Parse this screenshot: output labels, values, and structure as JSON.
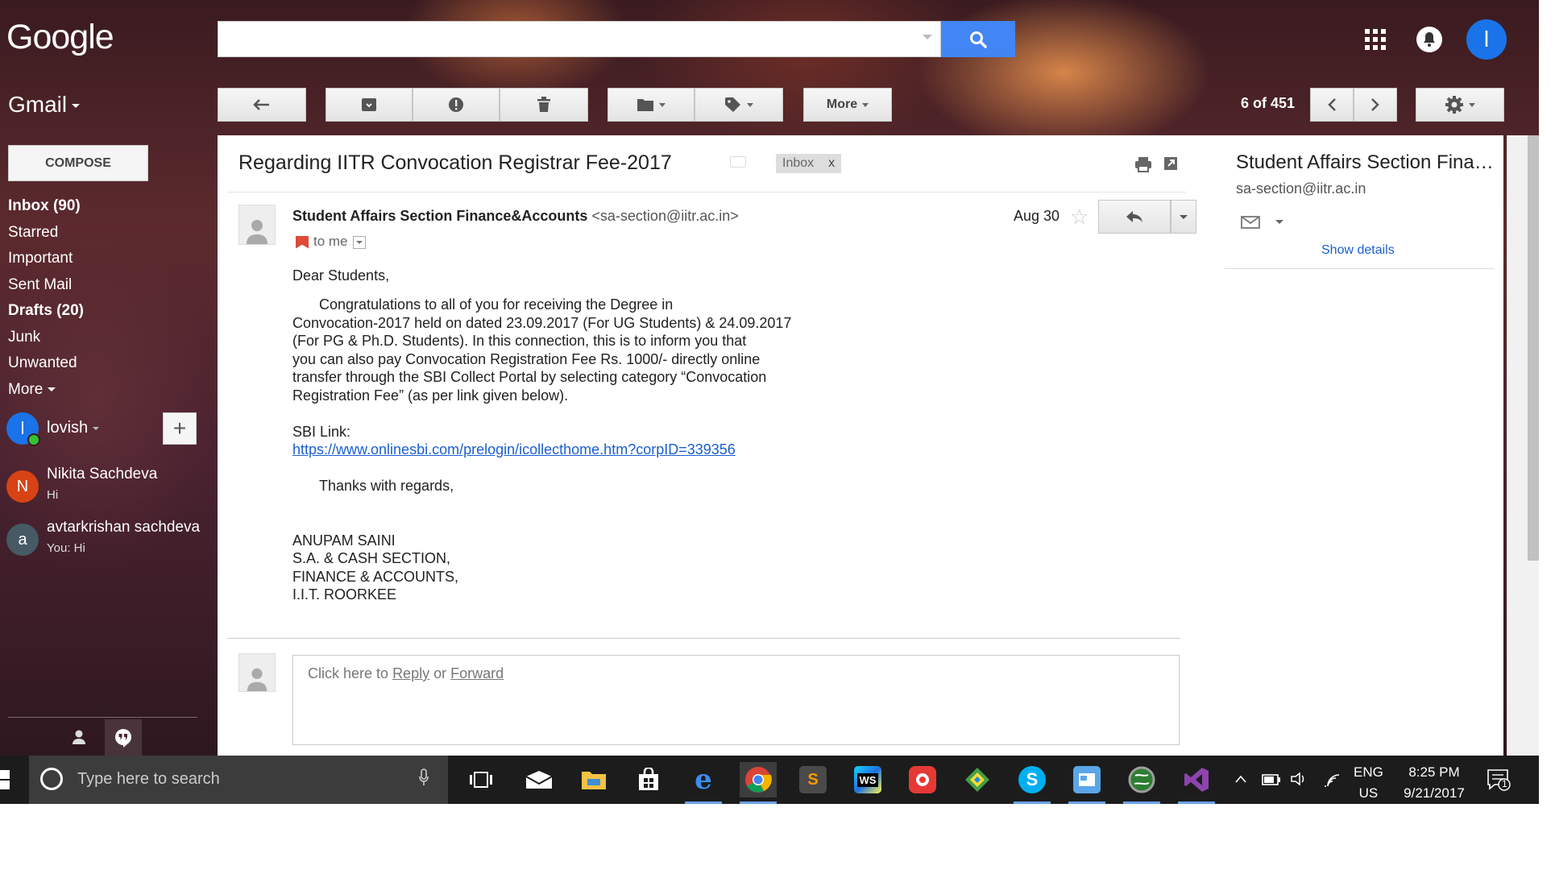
{
  "header": {
    "logo": "Google",
    "search_value": "",
    "search_icon": "magnifier-icon",
    "apps_icon": "apps-grid-icon",
    "notifications_icon": "bell-icon",
    "account_initial": "l"
  },
  "toolbar": {
    "app_label": "Gmail",
    "back_icon": "back-arrow-icon",
    "archive_icon": "archive-icon",
    "spam_icon": "report-spam-icon",
    "delete_icon": "trash-icon",
    "move_icon": "folder-icon",
    "labels_icon": "label-tag-icon",
    "more_label": "More",
    "count": "6 of 451",
    "prev_icon": "chevron-left-icon",
    "next_icon": "chevron-right-icon",
    "settings_icon": "gear-icon"
  },
  "sidebar": {
    "compose_label": "COMPOSE",
    "items": [
      {
        "label": "Inbox (90)",
        "bold": true
      },
      {
        "label": "Starred",
        "bold": false
      },
      {
        "label": "Important",
        "bold": false
      },
      {
        "label": "Sent Mail",
        "bold": false
      },
      {
        "label": "Drafts (20)",
        "bold": true
      },
      {
        "label": "Junk",
        "bold": false
      },
      {
        "label": "Unwanted",
        "bold": false
      }
    ],
    "more_label": "More",
    "user": {
      "initial": "l",
      "name": "lovish",
      "add_icon": "plus-icon"
    },
    "contacts": [
      {
        "initial": "N",
        "name": "Nikita Sachdeva",
        "message": "Hi",
        "color": "#d84315"
      },
      {
        "initial": "a",
        "name": "avtarkrishan sachdeva",
        "message": "You: Hi",
        "color": "#455a64"
      }
    ],
    "footer_icons": [
      "person-icon",
      "hangouts-quote-icon"
    ]
  },
  "email": {
    "subject": "Regarding IITR Convocation Registrar Fee-2017",
    "label_chip": "Inbox",
    "label_chip_close": "x",
    "print_icon": "printer-icon",
    "popout_icon": "new-window-icon",
    "sender_name": "Student Affairs Section Finance&Accounts",
    "sender_email": "<sa-section@iitr.ac.in>",
    "to": "to me",
    "date": "Aug 30",
    "star_icon": "star-icon",
    "reply_icon": "reply-arrow-icon",
    "greeting": "Dear Students,",
    "paragraph_lines": [
      "Congratulations to all of you for receiving the Degree in",
      "Convocation-2017 held on dated 23.09.2017 (For UG Students) & 24.09.2017",
      "(For PG & Ph.D. Students). In this connection, this is to inform you that",
      "you can also pay Convocation Registration Fee Rs. 1000/- directly online",
      "transfer through the SBI Collect Portal by selecting category “Convocation",
      "Registration Fee” (as per link given below)."
    ],
    "link_label": "SBI Link:",
    "link": "https://www.onlinesbi.com/prelogin/icollecthome.htm?corpID=339356",
    "thanks": "Thanks with regards,",
    "signature": [
      "ANUPAM SAINI",
      "S.A. & CASH SECTION,",
      "FINANCE & ACCOUNTS,",
      "I.I.T. ROORKEE"
    ],
    "reply_prompt_prefix": "Click here to",
    "reply_link": "Reply",
    "reply_or": "or",
    "forward_link": "Forward"
  },
  "contact_panel": {
    "name": "Student Affairs Section Finance&Accounts",
    "email": "sa-section@iitr.ac.in",
    "mail_icon": "envelope-icon",
    "show_details": "Show details"
  },
  "taskbar": {
    "search_placeholder": "Type here to search",
    "apps": [
      "task-view-icon",
      "mail-icon",
      "file-explorer-icon",
      "store-icon",
      "edge-icon",
      "chrome-icon",
      "sublime-icon",
      "webstorm-icon",
      "app-red-icon",
      "app-green-icon",
      "skype-icon",
      "app-blue-icon",
      "globe-icon",
      "visual-studio-icon"
    ],
    "lang_top": "ENG",
    "lang_bottom": "US",
    "time": "8:25 PM",
    "date": "9/21/2017",
    "notification_count": "1"
  },
  "colors": {
    "accent": "#4285f4",
    "link": "#1a5fcf",
    "important": "#dd4b39"
  }
}
